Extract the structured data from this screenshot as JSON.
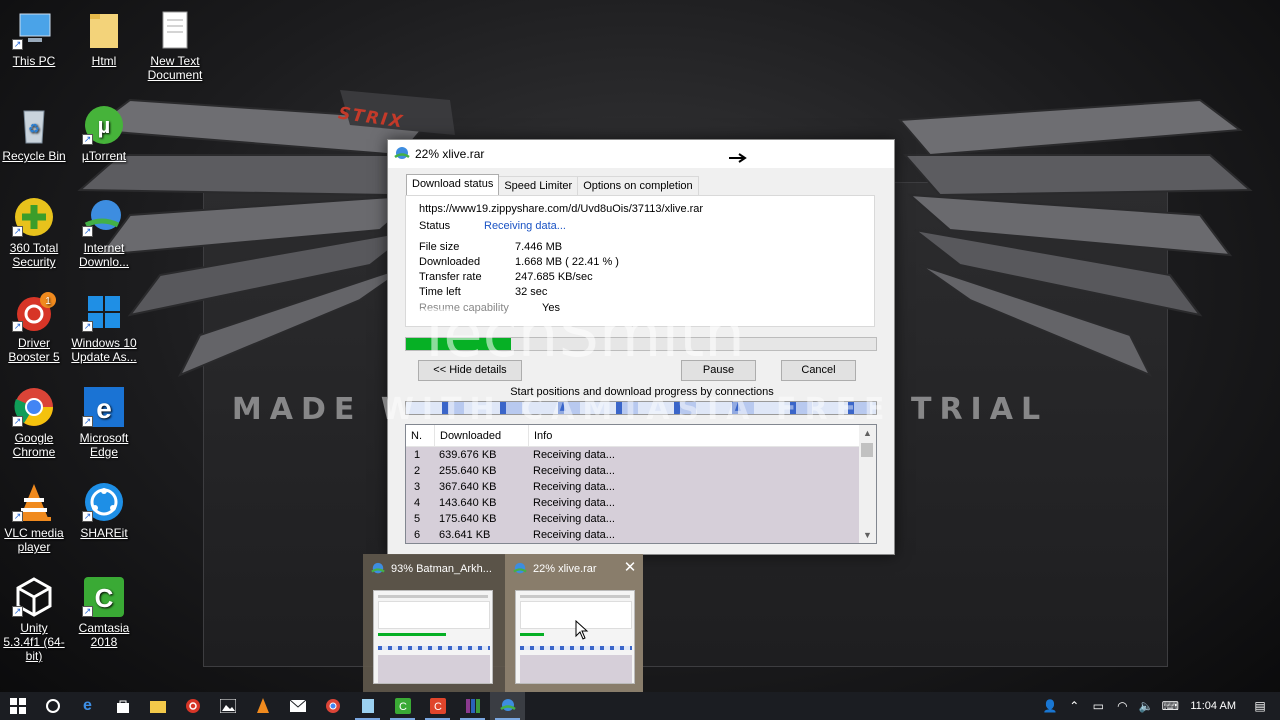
{
  "desktop": {
    "icons": [
      {
        "label": "This PC"
      },
      {
        "label": "Html"
      },
      {
        "label": "New Text Document"
      },
      {
        "label": "Recycle Bin"
      },
      {
        "label": "µTorrent"
      },
      {
        "label": "360 Total Security"
      },
      {
        "label": "Internet Downlo..."
      },
      {
        "label": "Driver Booster 5",
        "badge": "1"
      },
      {
        "label": "Windows 10 Update As..."
      },
      {
        "label": "Google Chrome"
      },
      {
        "label": "Microsoft Edge"
      },
      {
        "label": "VLC media player"
      },
      {
        "label": "SHAREit"
      },
      {
        "label": "Unity 5.3.4f1 (64-bit)"
      },
      {
        "label": "Camtasia 2018"
      }
    ],
    "wallpaper_text": "STRIX"
  },
  "watermark": {
    "line": "MADE WITH CAMTASIA FREE TRIAL",
    "logo": "TechSmith"
  },
  "idm_window": {
    "title": "22% xlive.rar",
    "tabs": [
      "Download status",
      "Speed Limiter",
      "Options on completion"
    ],
    "url": "https://www19.zippyshare.com/d/Uvd8uOis/37113/xlive.rar",
    "status_label": "Status",
    "status_value": "Receiving data...",
    "file_size_label": "File size",
    "file_size_value": "7.446  MB",
    "downloaded_label": "Downloaded",
    "downloaded_value": "1.668  MB  ( 22.41 % )",
    "transfer_rate_label": "Transfer rate",
    "transfer_rate_value": "247.685  KB/sec",
    "time_left_label": "Time left",
    "time_left_value": "32 sec",
    "resume_label": "Resume capability",
    "resume_value": "Yes",
    "progress_fraction": 0.2241,
    "hide_details_label": "<< Hide details",
    "pause_label": "Pause",
    "cancel_label": "Cancel",
    "connections_label": "Start positions and download progress by connections",
    "columns": [
      "N.",
      "Downloaded",
      "Info"
    ],
    "connections": [
      {
        "n": "1",
        "downloaded": "639.676  KB",
        "info": "Receiving data..."
      },
      {
        "n": "2",
        "downloaded": "255.640  KB",
        "info": "Receiving data..."
      },
      {
        "n": "3",
        "downloaded": "367.640  KB",
        "info": "Receiving data..."
      },
      {
        "n": "4",
        "downloaded": "143.640  KB",
        "info": "Receiving data..."
      },
      {
        "n": "5",
        "downloaded": "175.640  KB",
        "info": "Receiving data..."
      },
      {
        "n": "6",
        "downloaded": "63.641  KB",
        "info": "Receiving data..."
      }
    ]
  },
  "taskbar_preview": {
    "items": [
      {
        "title": "93% Batman_Arkh..."
      },
      {
        "title": "22% xlive.rar"
      }
    ]
  },
  "taskbar": {
    "apps": [
      "start",
      "search",
      "edge",
      "store",
      "explorer",
      "driver-booster",
      "photos",
      "vlc",
      "mail",
      "chrome",
      "notepad",
      "camtasia",
      "camtasia-recorder",
      "winrar",
      "idm"
    ],
    "clock": "11:04 AM"
  },
  "colors": {
    "progress_green": "#06b025",
    "status_blue": "#1a53c4",
    "row_highlight": "#d6cfd9"
  }
}
